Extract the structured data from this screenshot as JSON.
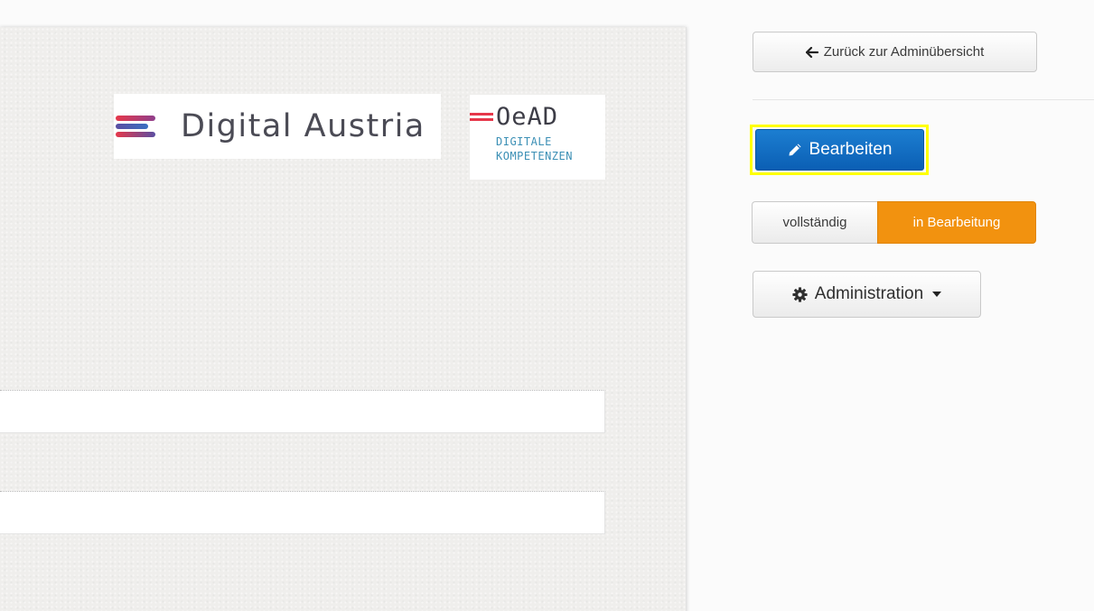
{
  "logos": {
    "digital_austria": {
      "text": "Digital Austria"
    },
    "oead": {
      "word": "OeAD",
      "line1": "DIGITALE",
      "line2": "KOMPETENZEN"
    }
  },
  "sidebar": {
    "back_button": {
      "label": "Zurück zur Adminübersicht",
      "icon": "arrow-left-icon"
    },
    "edit_button": {
      "label": "Bearbeiten",
      "icon": "pencil-icon",
      "color": "#0b6ac4",
      "highlight_color": "#ffff00"
    },
    "status": {
      "options": [
        "vollständig",
        "in Bearbeitung"
      ],
      "selected": "in Bearbeitung",
      "selected_color": "#f2920f"
    },
    "admin_dropdown": {
      "label": "Administration",
      "icon": "gear-icon"
    }
  },
  "form": {
    "field_a": {
      "value": ""
    },
    "field_b": {
      "value": ""
    }
  }
}
